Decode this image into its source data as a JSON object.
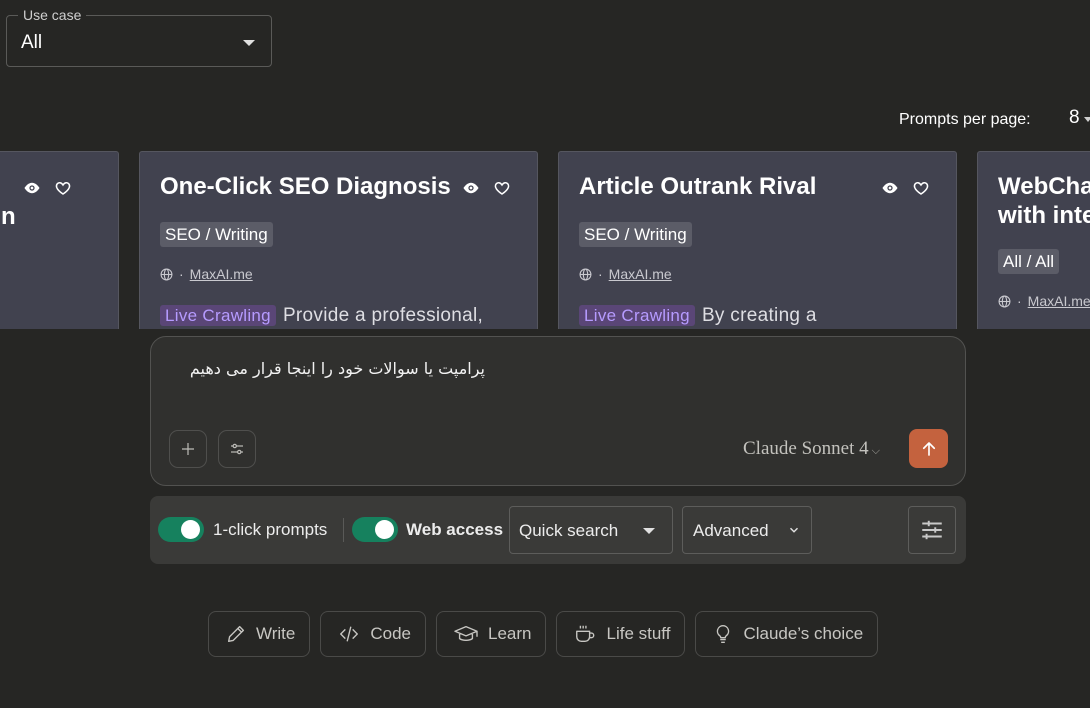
{
  "use_case": {
    "legend": "Use case",
    "value": "All"
  },
  "pagination": {
    "label": "Prompts per page:",
    "value": "8"
  },
  "cards": [
    {
      "title": "n",
      "title_line2": ""
    },
    {
      "title": "One-Click SEO Diagnosis",
      "tag": "SEO / Writing",
      "source": "MaxAI.me",
      "badge": "Live Crawling",
      "desc": "Provide a professional,"
    },
    {
      "title": "Article Outrank Rival",
      "tag": "SEO / Writing",
      "source": "MaxAI.me",
      "badge": "Live Crawling",
      "desc": "By creating a"
    },
    {
      "title": "WebChat",
      "title_line2": "with inte",
      "tag": "All / All",
      "source": "MaxAI.me"
    }
  ],
  "prompt": {
    "text": "پرامپت یا سوالات خود را اینجا قرار می دهیم",
    "model": "Claude Sonnet 4"
  },
  "toolbar": {
    "one_click_label": "1-click prompts",
    "web_access_label": "Web access",
    "search_mode": "Quick search",
    "advanced_label": "Advanced"
  },
  "chips": [
    {
      "label": "Write",
      "icon": "pencil-icon"
    },
    {
      "label": "Code",
      "icon": "code-icon"
    },
    {
      "label": "Learn",
      "icon": "graduation-cap-icon"
    },
    {
      "label": "Life stuff",
      "icon": "coffee-cup-icon"
    },
    {
      "label": "Claude’s choice",
      "icon": "lightbulb-icon"
    }
  ],
  "colors": {
    "accent_send": "#c4623e",
    "toggle_on": "#16815e",
    "card_bg": "#41424f",
    "live_badge": "#b69bff"
  }
}
